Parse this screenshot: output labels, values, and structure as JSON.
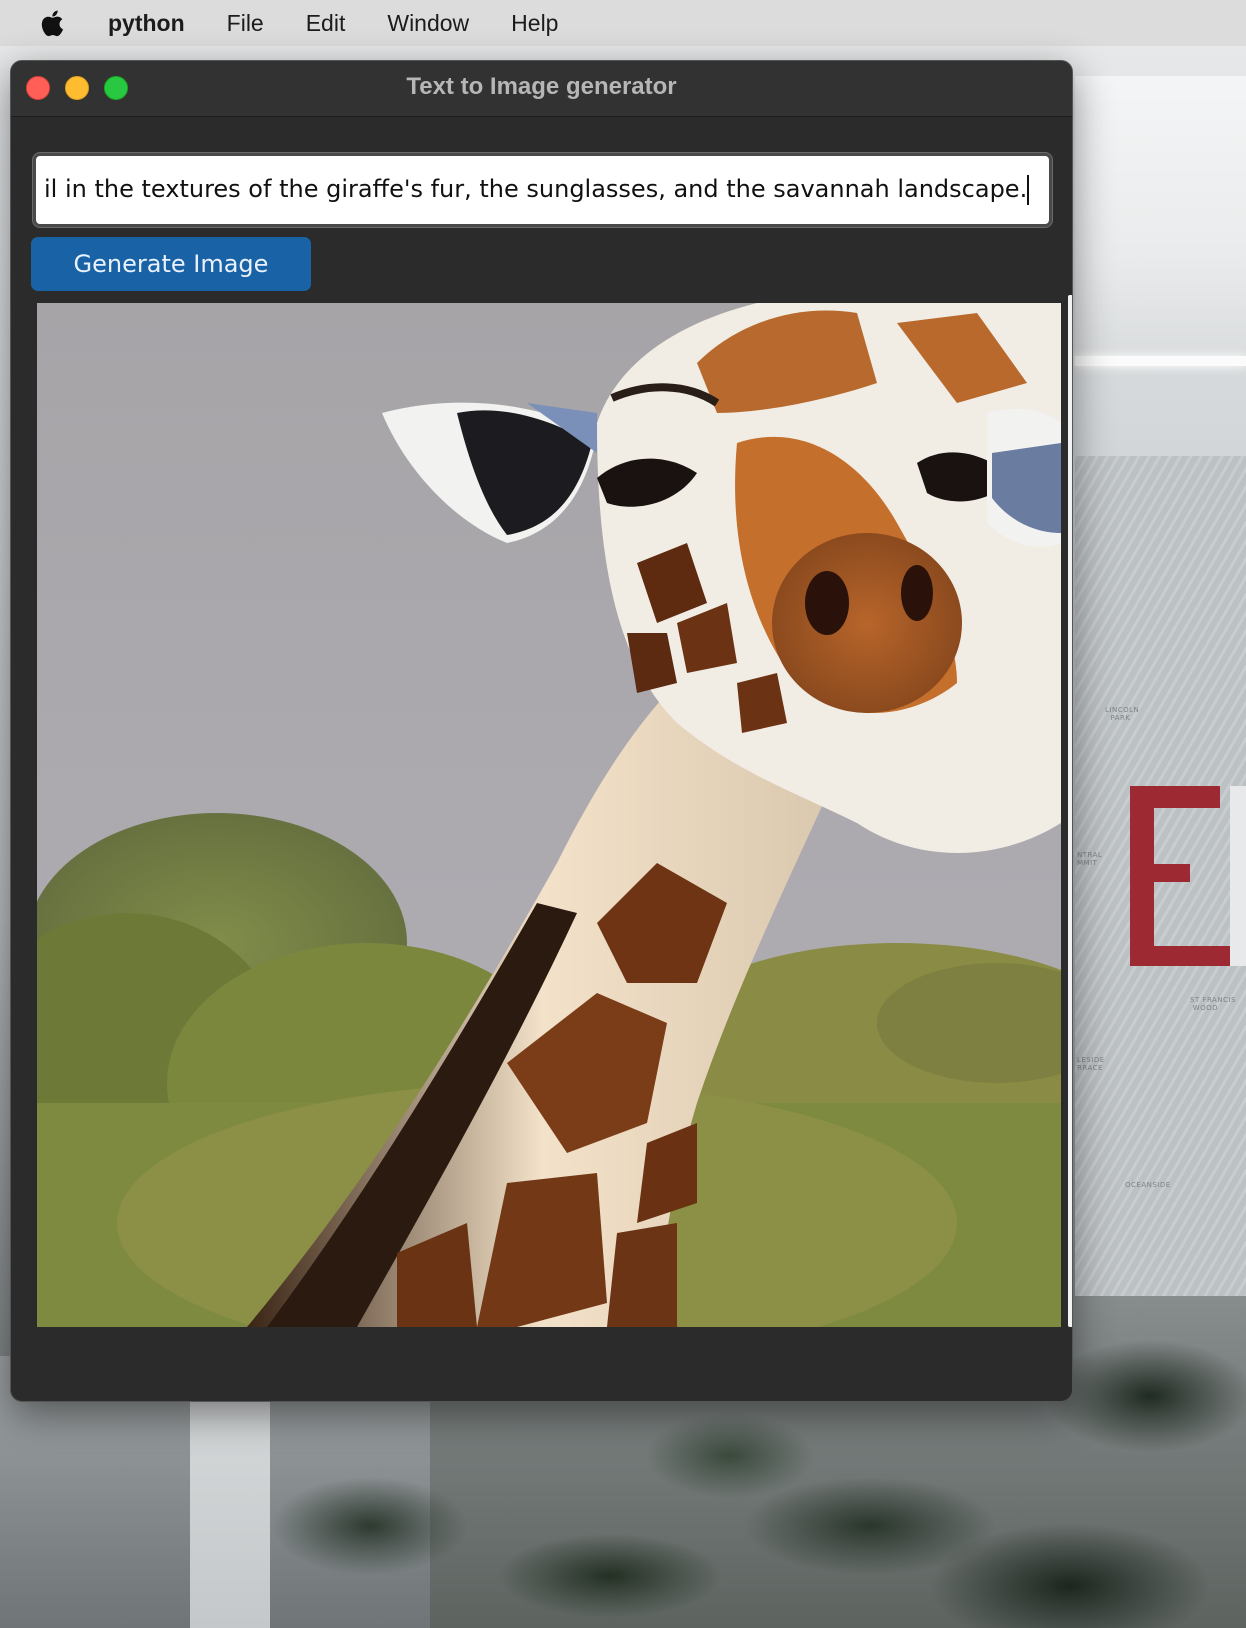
{
  "menubar": {
    "app_name": "python",
    "items": [
      "File",
      "Edit",
      "Window",
      "Help"
    ]
  },
  "window": {
    "title": "Text to Image generator",
    "prompt_input": {
      "value": "il in the textures of the giraffe's fur, the sunglasses, and the savannah landscape."
    },
    "generate_button": {
      "label": "Generate Image"
    },
    "image": {
      "subject": "giraffe"
    }
  },
  "colors": {
    "button": "#1962a6",
    "window_bg": "#2b2b2b",
    "close": "#ff5f57",
    "minimize": "#febc2e",
    "zoom": "#28c840"
  }
}
